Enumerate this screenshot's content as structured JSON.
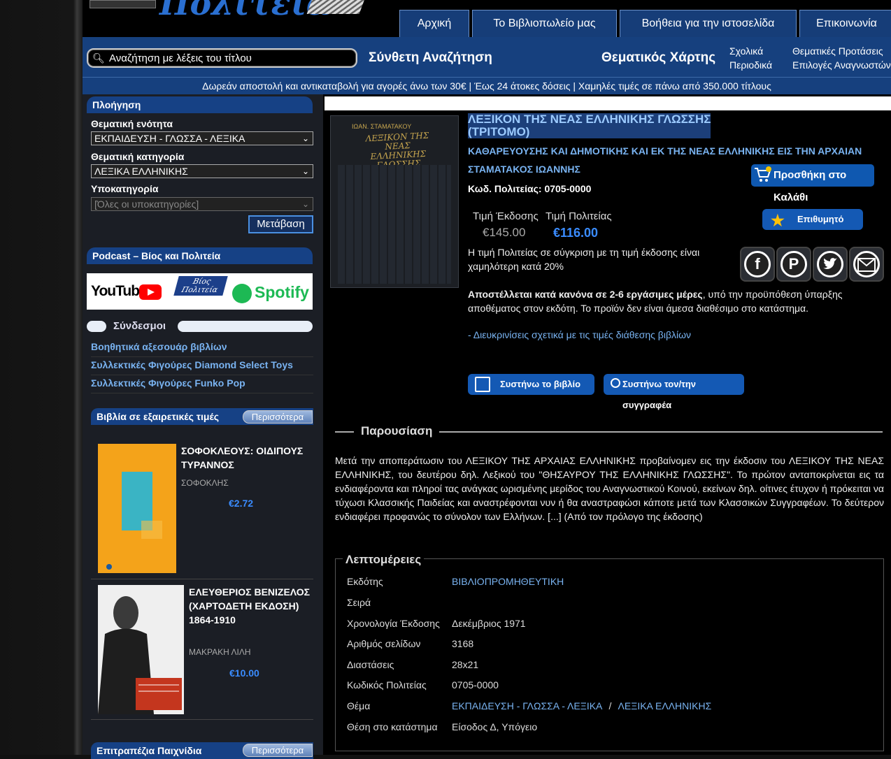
{
  "header": {
    "logo_text": "Πολιτεία",
    "nav": [
      {
        "label": "Αρχική"
      },
      {
        "label": "Το Βιβλιοπωλείο μας"
      },
      {
        "label": "Βοήθεια για την ιστοσελίδα"
      },
      {
        "label": "Επικοινωνία"
      }
    ]
  },
  "searchbar": {
    "placeholder": "Αναζήτηση με λέξεις του τίτλου",
    "advanced": "Σύνθετη Αναζήτηση",
    "thematic_map": "Θεματικός Χάρτης",
    "school": "Σχολικά",
    "periodicals": "Περιοδικά",
    "thematic_suggestions": "Θεματικές Προτάσεις",
    "reader_choices": "Επιλογές Αναγνωστών"
  },
  "shipping_banner": "Δωρεάν αποστολή και αντικαταβολή για αγορές άνω των 30€ | Έως 24 άτοκες δόσεις | Χαμηλές τιμές σε πάνω από 350.000 τίτλους",
  "sidebar": {
    "nav_title": "Πλοήγηση",
    "section_label": "Θεματική ενότητα",
    "section_value": "ΕΚΠΑΙΔΕΥΣΗ - ΓΛΩΣΣΑ - ΛΕΞΙΚΑ",
    "category_label": "Θεματική κατηγορία",
    "category_value": "ΛΕΞΙΚΑ ΕΛΛΗΝΙΚΗΣ",
    "subcategory_label": "Υποκατηγορία",
    "subcategory_value": "[Όλες οι υποκατηγορίες]",
    "go_button": "Μετάβαση",
    "podcast_title": "Podcast – Βίος και Πολιτεία",
    "banner": {
      "youtube": "YouTube",
      "vios": "Βίος",
      "politeia": "Πολιτεία",
      "spotify": "Spotify"
    },
    "links_title": "Σύνδεσμοι",
    "links": [
      "Βοηθητικά αξεσουάρ βιβλίων",
      "Συλλεκτικές Φιγούρες Diamond Select Toys",
      "Συλλεκτικές Φιγούρες Funko Pop"
    ],
    "offers_title": "Βιβλία σε εξαιρετικές τιμές",
    "more_label": "Περισσότερα",
    "offers": [
      {
        "title": "ΣΟΦΟΚΛΕΟΥΣ: ΟΙΔΙΠΟΥΣ ΤΥΡΑΝΝΟΣ",
        "author": "ΣΟΦΟΚΛΗΣ",
        "price": "€2.72"
      },
      {
        "title": "ΕΛΕΥΘΕΡΙΟΣ ΒΕΝΙΖΕΛΟΣ (ΧΑΡΤΟΔΕΤΗ ΕΚΔΟΣΗ) 1864-1910",
        "author": "ΜΑΚΡΑΚΗ ΛΙΛΗ",
        "price": "€10.00"
      }
    ],
    "games_title": "Επιτραπέζια Παιχνίδια"
  },
  "book": {
    "cover_author": "ΙΩΑΝ. ΣΤΑΜΑΤΑΚΟΥ",
    "cover_title": "ΛΕΞΙΚΟΝ ΤΗΣ ΝΕΑΣ ΕΛΛΗΝΙΚΗΣ ΓΛΩΣΣΗΣ",
    "title_line1": "ΛΕΞΙΚΟΝ ΤΗΣ ΝΕΑΣ ΕΛΛΗΝΙΚΗΣ ΓΛΩΣΣΗΣ",
    "title_line2": "(ΤΡΙΤΟΜΟ)",
    "subtitle": "ΚΑΘΑΡΕΥΟΥΣΗΣ ΚΑΙ ΔΗΜΟΤΙΚΗΣ ΚΑΙ ΕΚ ΤΗΣ ΝΕΑΣ ΕΛΛΗΝΙΚΗΣ ΕΙΣ ΤΗΝ ΑΡΧΑΙΑΝ",
    "author": "ΣΤΑΜΑΤΑΚΟΣ ΙΩΑΝΝΗΣ",
    "code": "Κωδ. Πολιτείας: 0705-0000",
    "price_issue_label": "Τιμή Έκδοσης",
    "price_store_label": "Τιμή Πολιτείας",
    "price_issue": "€145.00",
    "price_store": "€116.00",
    "price_note": "Η τιμή Πολιτείας σε σύγκριση με τη τιμή έκδοσης είναι χαμηλότερη κατά 20%",
    "shipping_bold": "Αποστέλλεται κατά κανόνα σε 2-6 εργάσιμες μέρες",
    "shipping_rest": ", υπό την προϋπόθεση ύπαρξης αποθέματος στον εκδότη. Το προϊόν δεν είναι άμεσα διαθέσιμο στο κατάστημα.",
    "clarify": "- Διευκρινίσεις σχετικά με τις τιμές διάθεσης βιβλίων",
    "add_to_cart": "Προσθήκη στο Καλάθι",
    "wishlist": "Επιθυμητό",
    "recommend_book": "Συστήνω το βιβλίο",
    "recommend_author": "Συστήνω τον/την συγγραφέα"
  },
  "presentation": {
    "title": "Παρουσίαση",
    "text": "Μετά την αποπεράτωσιν του ΛΕΞΙΚΟΥ ΤΗΣ ΑΡΧΑΙΑΣ ΕΛΛΗΝΙΚΗΣ προβαίνομεν εις την έκδοσιν του ΛΕΞΙΚΟΥ ΤΗΣ ΝΕΑΣ ΕΛΛΗΝΙΚΗΣ, του δευτέρου δηλ. Λεξικού του \"ΘΗΣΑΥΡΟΥ ΤΗΣ ΕΛΛΗΝΙΚΗΣ ΓΛΩΣΣΗΣ\". Το πρώτον ανταποκρίνεται εις τα ενδιαφέροντα και πληροί τας ανάγκας ωρισμένης μερίδος του Αναγνωστικού Κοινού, εκείνων δηλ. οίτινες έτυχον ή πρόκειται να τύχωσι Κλασσικής Παιδείας και αναστρέφονται νυν ή θα αναστραφώσι κάποτε μετά των Κλασσικών Συγγραφέων. Το δεύτερον ενδιαφέρει προφανώς το σύνολον των Ελλήνων. [...] (Από τον πρόλογο της έκδοσης)"
  },
  "details": {
    "title": "Λεπτομέρειες",
    "rows": [
      {
        "key": "Εκδότης",
        "value": "ΒΙΒΛΙΟΠΡΟΜΗΘΕΥΤΙΚΗ"
      },
      {
        "key": "Σειρά",
        "value": ""
      },
      {
        "key": "Χρονολογία Έκδοσης",
        "value": "Δεκέμβριος 1971"
      },
      {
        "key": "Αριθμός σελίδων",
        "value": "3168"
      },
      {
        "key": "Διαστάσεις",
        "value": "28x21"
      },
      {
        "key": "Κωδικός Πολιτείας",
        "value": "0705-0000"
      },
      {
        "key": "Θέμα",
        "value": "ΕΚΠΑΙΔΕΥΣΗ - ΓΛΩΣΣΑ - ΛΕΞΙΚΑ",
        "value2": "ΛΕΞΙΚΑ ΕΛΛΗΝΙΚΗΣ",
        "sep": "/"
      },
      {
        "key": "Θέση στο κατάστημα",
        "value": "Είσοδος Δ, Υπόγειο"
      }
    ]
  },
  "colors": {
    "accent_blue": "#16407e",
    "link_blue": "#79b3f1",
    "price_blue": "#3a8cff"
  }
}
